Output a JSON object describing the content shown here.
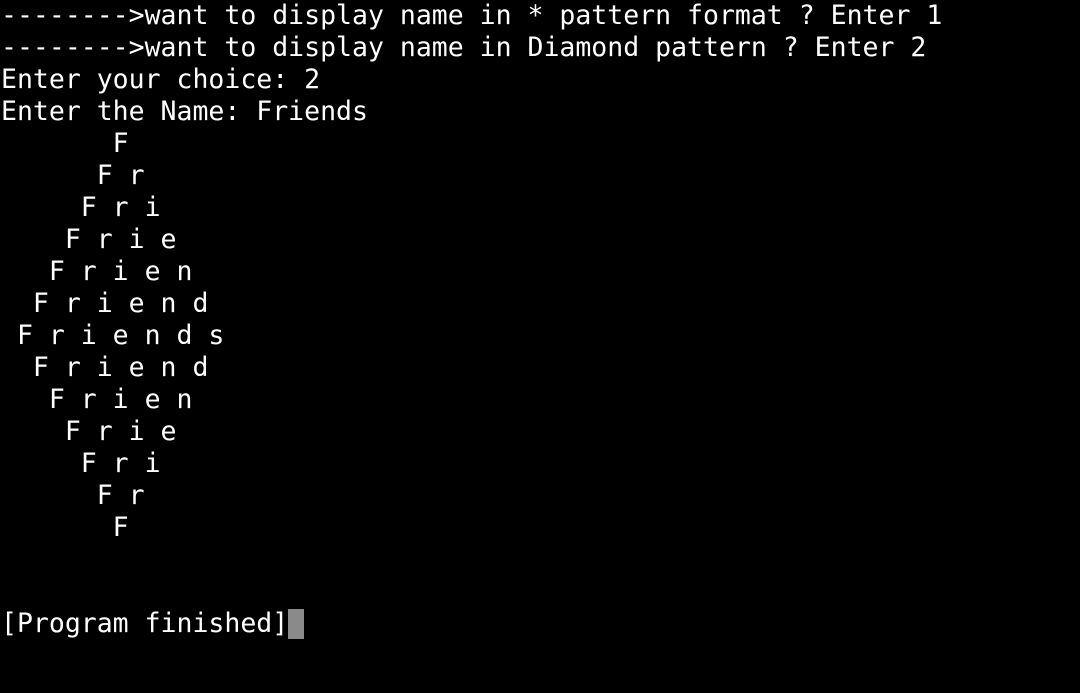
{
  "terminal": {
    "menu_option_1": "-------->want to display name in * pattern format ? Enter 1",
    "menu_option_2": "-------->want to display name in Diamond pattern ? Enter 2",
    "choice_prompt": "Enter your choice: 2",
    "name_prompt": "Enter the Name: Friends",
    "pattern_lines": [
      "       F",
      "      F r",
      "     F r i",
      "    F r i e",
      "   F r i e n",
      "  F r i e n d",
      " F r i e n d s",
      "  F r i e n d",
      "   F r i e n",
      "    F r i e",
      "     F r i",
      "      F r",
      "       F"
    ],
    "status": "[Program finished]"
  },
  "colors": {
    "background": "#000000",
    "text": "#ffffff",
    "cursor": "#8a8a8a"
  }
}
